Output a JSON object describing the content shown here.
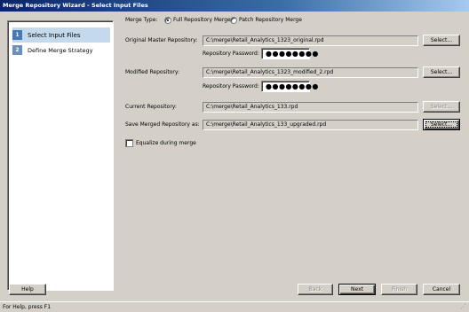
{
  "window": {
    "title": "Merge Repository Wizard - Select Input Files"
  },
  "steps": [
    {
      "number": "1",
      "label": "Select Input Files"
    },
    {
      "number": "2",
      "label": "Define Merge Strategy"
    }
  ],
  "merge_type": {
    "label": "Merge Type:",
    "options": [
      {
        "label": "Full Repository Merge",
        "selected": true
      },
      {
        "label": "Patch Repository Merge",
        "selected": false
      }
    ]
  },
  "original": {
    "label": "Original Master Repository:",
    "path": "C:\\merge\\Retail_Analytics_1323_original.rpd",
    "password_label": "Repository Password:",
    "password": "●●●●●●●●",
    "select_label": "Select..."
  },
  "modified": {
    "label": "Modified Repository:",
    "path": "C:\\merge\\Retail_Analytics_1323_modified_2.rpd",
    "password_label": "Repository Password:",
    "password": "●●●●●●●●",
    "select_label": "Select..."
  },
  "current": {
    "label": "Current Repository:",
    "path": "C:\\merge\\Retail_Analytics_133.rpd",
    "select_label": "Select..."
  },
  "save_merged": {
    "label": "Save Merged Repository as:",
    "path": "C:\\merge\\Retail_Analytics_133_upgraded.rpd",
    "select_label": "Select..."
  },
  "equalize": {
    "label": "Equalize during merge",
    "checked": false
  },
  "buttons": {
    "help": "Help",
    "back": "Back",
    "next": "Next",
    "finish": "Finish",
    "cancel": "Cancel"
  },
  "status_bar": {
    "text": "For Help, press F1"
  }
}
